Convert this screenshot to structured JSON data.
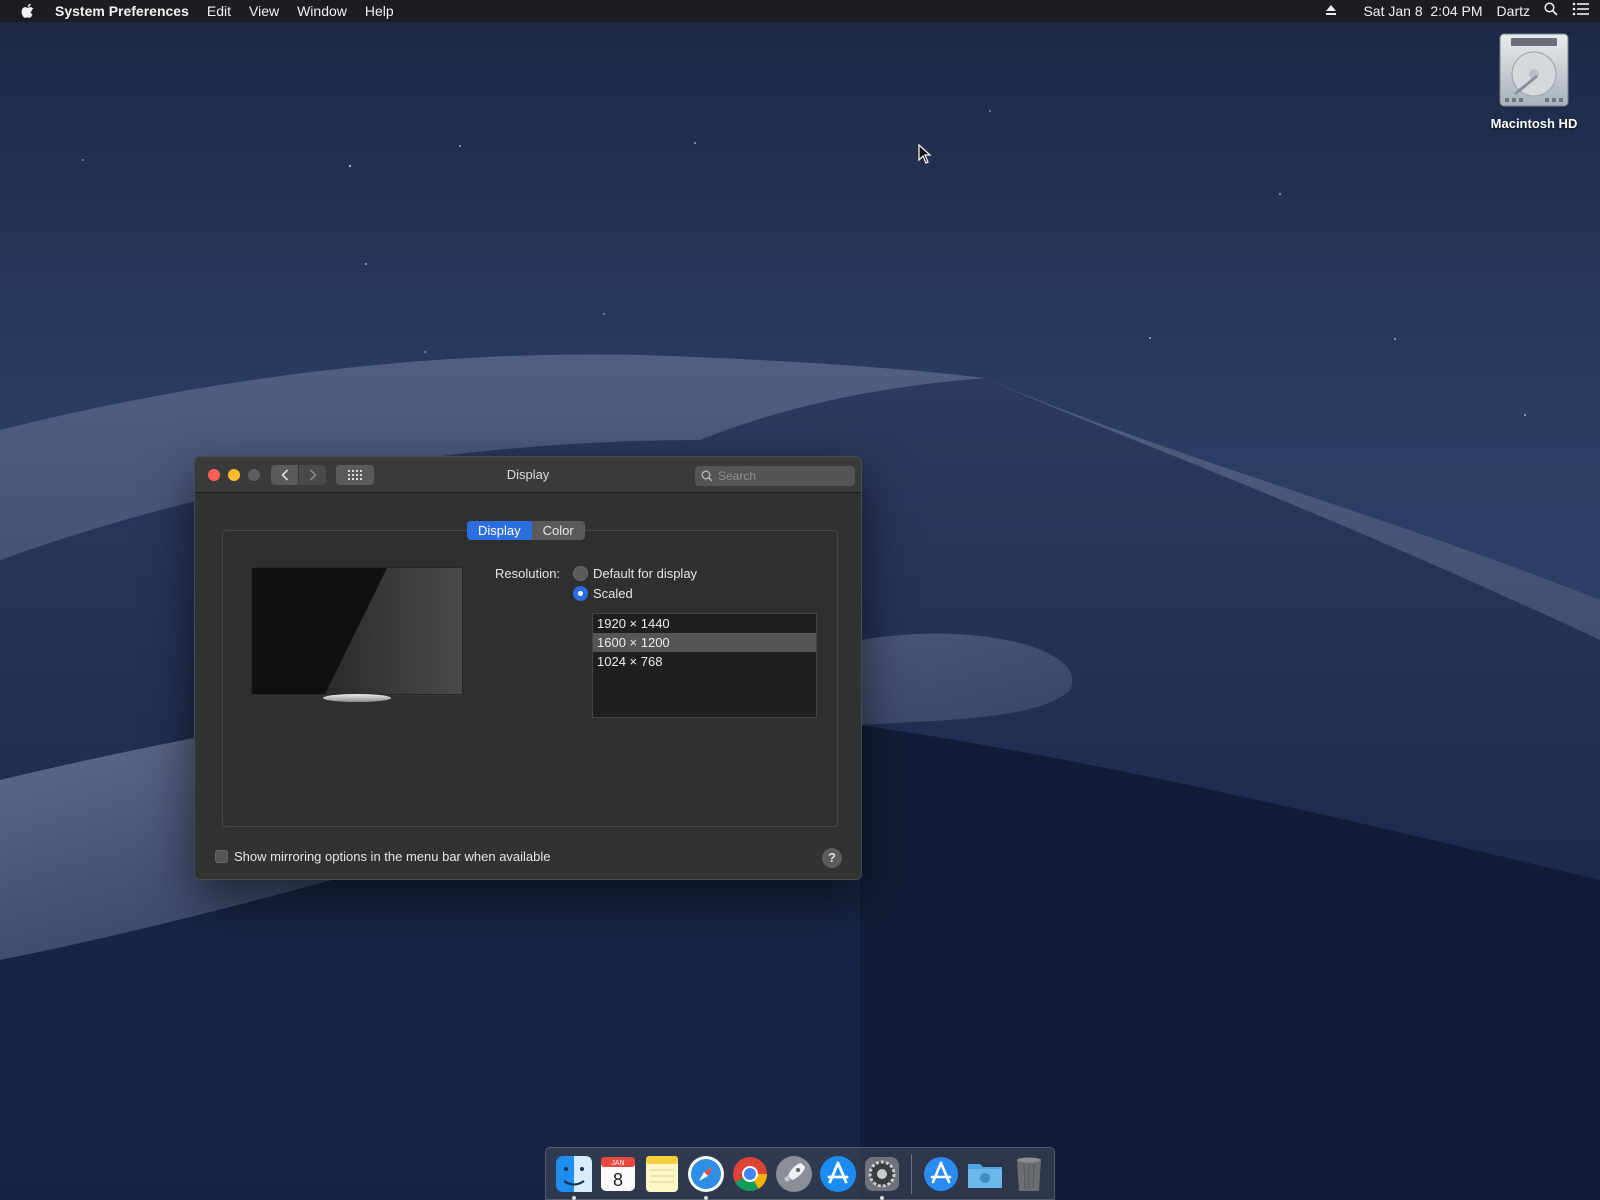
{
  "menubar": {
    "app_name": "System Preferences",
    "menus": [
      "Edit",
      "View",
      "Window",
      "Help"
    ],
    "clock": "Sat Jan 8  2:04 PM",
    "user": "Dartz"
  },
  "desktop": {
    "hd_label": "Macintosh HD"
  },
  "window": {
    "title": "Display",
    "search_placeholder": "Search",
    "tabs": [
      {
        "label": "Display",
        "active": true
      },
      {
        "label": "Color",
        "active": false
      }
    ],
    "resolution_label": "Resolution:",
    "options": [
      {
        "label": "Default for display",
        "selected": false
      },
      {
        "label": "Scaled",
        "selected": true
      }
    ],
    "resolutions": [
      "1920 × 1440",
      "1600 × 1200",
      "1024 × 768"
    ],
    "selected_resolution_index": 1,
    "mirroring_label": "Show mirroring options in the menu bar when available",
    "mirroring_checked": false,
    "help_label": "?"
  },
  "dock": {
    "calendar_day": "8",
    "calendar_month": "JAN",
    "items": [
      {
        "icon": "finder-icon",
        "running": true
      },
      {
        "icon": "calendar-icon",
        "running": false
      },
      {
        "icon": "notes-icon",
        "running": false
      },
      {
        "icon": "safari-icon",
        "running": true
      },
      {
        "icon": "chrome-icon",
        "running": false
      },
      {
        "icon": "launchpad-icon",
        "running": false
      },
      {
        "icon": "app-store-icon",
        "running": false
      },
      {
        "icon": "system-preferences-icon",
        "running": true
      },
      {
        "icon": "applications-folder-icon",
        "running": false
      },
      {
        "icon": "downloads-folder-icon",
        "running": false
      },
      {
        "icon": "trash-icon",
        "running": false
      }
    ]
  },
  "colors": {
    "accent": "#2c6ee0",
    "close": "#ff5f57",
    "minimize": "#febc2e"
  }
}
